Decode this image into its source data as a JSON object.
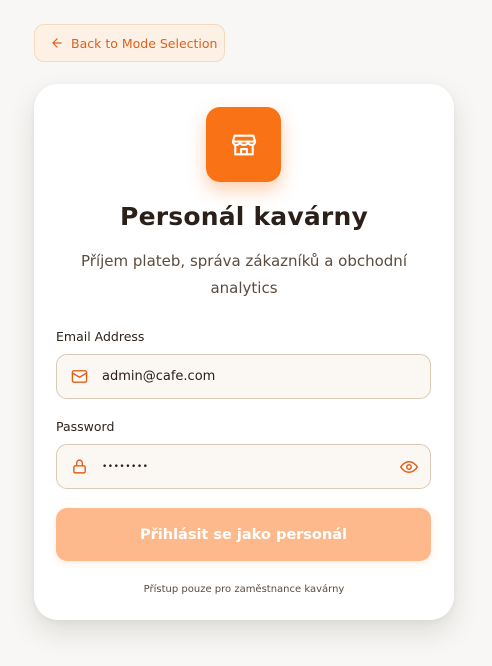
{
  "back_button": {
    "label": "Back to Mode Selection",
    "icon": "arrow-left-icon"
  },
  "header": {
    "logo_icon": "store-icon",
    "title": "Personál kavárny",
    "subtitle": "Příjem plateb, správa zákazníků a obchodní analytics"
  },
  "form": {
    "email": {
      "label": "Email Address",
      "value": "admin@cafe.com",
      "icon": "mail-icon"
    },
    "password": {
      "label": "Password",
      "value": "........",
      "icon": "lock-icon",
      "toggle_icon": "eye-icon"
    },
    "submit_label": "Přihlásit se jako personál",
    "footnote": "Přístup pouze pro zaměstnance kavárny"
  },
  "colors": {
    "accent": "#f97316",
    "accent_light": "#fdb98b",
    "background": "#f8f7f5",
    "card": "#ffffff"
  }
}
